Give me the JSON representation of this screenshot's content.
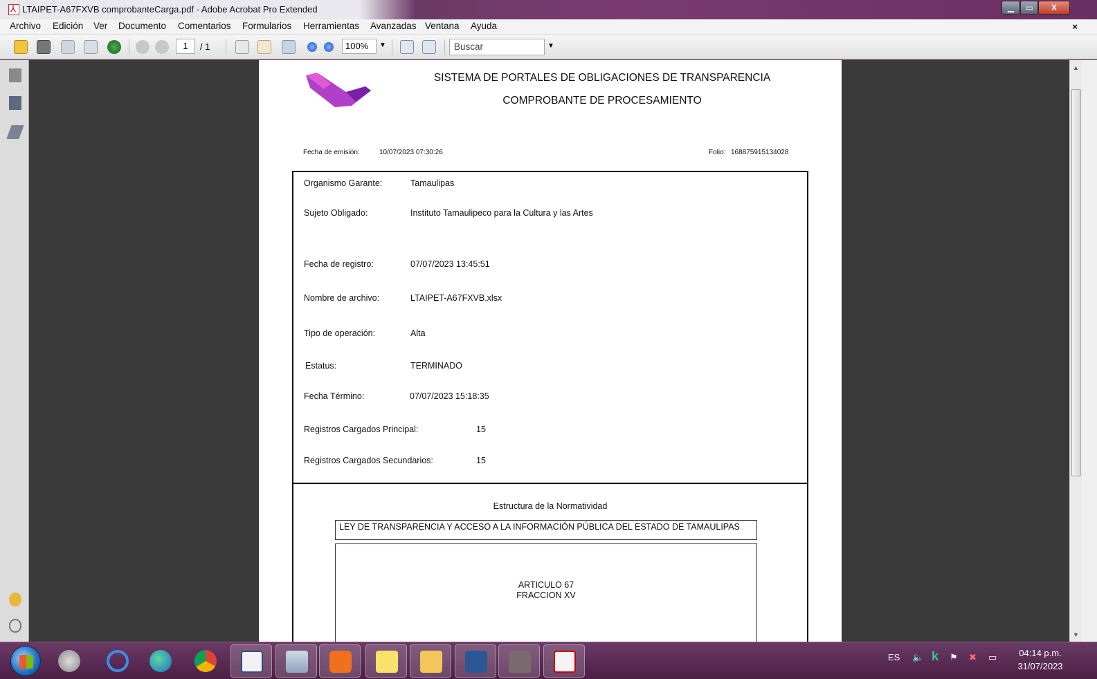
{
  "window": {
    "title": "LTAIPET-A67FXVB comprobanteCarga.pdf - Adobe Acrobat Pro Extended",
    "minimize_icon": "minimize-icon",
    "maximize_icon": "maximize-icon",
    "close_label": "X"
  },
  "menu": {
    "items": [
      "Archivo",
      "Edición",
      "Ver",
      "Documento",
      "Comentarios",
      "Formularios",
      "Herramientas",
      "Avanzadas",
      "Ventana",
      "Ayuda"
    ],
    "close_doc": "×"
  },
  "toolbar": {
    "page_current": "1",
    "page_total": "/ 1",
    "zoom": "100%",
    "search_placeholder": "Buscar"
  },
  "document": {
    "header_line1": "SISTEMA DE PORTALES DE OBLIGACIONES DE TRANSPARENCIA",
    "header_line2": "COMPROBANTE DE PROCESAMIENTO",
    "fecha_emision_label": "Fecha de emisión:",
    "fecha_emision_value": "10/07/2023 07:30:26",
    "folio_label": "Folio:",
    "folio_value": "168875915134028",
    "rows": [
      {
        "label": "Organismo Garante:",
        "value": "Tamaulipas"
      },
      {
        "label": "Sujeto Obligado:",
        "value": "Instituto Tamaulipeco para la Cultura y las Artes"
      },
      {
        "label": "Fecha de registro:",
        "value": "07/07/2023 13:45:51"
      },
      {
        "label": "Nombre  de archivo:",
        "value": "LTAIPET-A67FXVB.xlsx"
      },
      {
        "label": "Tipo de operación:",
        "value": "Alta"
      },
      {
        "label": "Estatus:",
        "value": "TERMINADO"
      },
      {
        "label": "Fecha Término:",
        "value": "07/07/2023 15:18:35"
      },
      {
        "label": "Registros Cargados Principal:",
        "value": "15"
      },
      {
        "label": "Registros Cargados Secundarios:",
        "value": "15"
      }
    ],
    "norm_title": "Estructura de la Normatividad",
    "law": "LEY DE TRANSPARENCIA Y ACCESO A LA INFORMACIÓN PÚBLICA DEL ESTADO DE TAMAULIPAS",
    "article": "ARTICULO 67",
    "fraction": "FRACCION XV"
  },
  "taskbar": {
    "lang": "ES",
    "time": "04:14 p.m.",
    "date": "31/07/2023"
  }
}
